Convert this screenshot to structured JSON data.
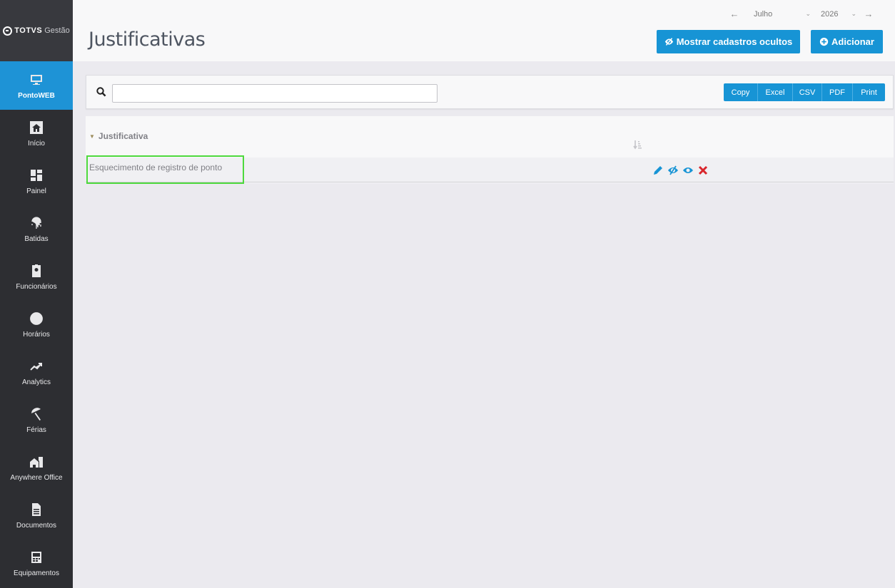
{
  "brand": {
    "name": "TOTVS",
    "product": "Gestão"
  },
  "sidebar": {
    "items": [
      {
        "label": "PontoWEB",
        "icon": "monitor-icon",
        "active": true
      },
      {
        "label": "Início",
        "icon": "home-icon"
      },
      {
        "label": "Painel",
        "icon": "dashboard-icon"
      },
      {
        "label": "Batidas",
        "icon": "fingerprint-icon"
      },
      {
        "label": "Funcionários",
        "icon": "id-badge-icon"
      },
      {
        "label": "Horários",
        "icon": "clock-icon"
      },
      {
        "label": "Analytics",
        "icon": "trend-icon"
      },
      {
        "label": "Férias",
        "icon": "umbrella-beach-icon"
      },
      {
        "label": "Anywhere Office",
        "icon": "house-office-icon"
      },
      {
        "label": "Documentos",
        "icon": "document-icon"
      },
      {
        "label": "Equipamentos",
        "icon": "device-icon"
      }
    ]
  },
  "header": {
    "title": "Justificativas",
    "period": {
      "month": "Julho",
      "year": "2026"
    },
    "buttons": {
      "show_hidden": "Mostrar cadastros ocultos",
      "add": "Adicionar"
    }
  },
  "toolbar": {
    "search_value": "",
    "export": [
      "Copy",
      "Excel",
      "CSV",
      "PDF",
      "Print"
    ]
  },
  "table": {
    "columns": [
      "Justificativa"
    ],
    "rows": [
      {
        "justificativa": "Esquecimento de registro de ponto"
      }
    ]
  },
  "colors": {
    "accent": "#1794d5",
    "sidebar": "#2d2e32",
    "highlight": "#4ed93d",
    "delete": "#d9262c"
  }
}
